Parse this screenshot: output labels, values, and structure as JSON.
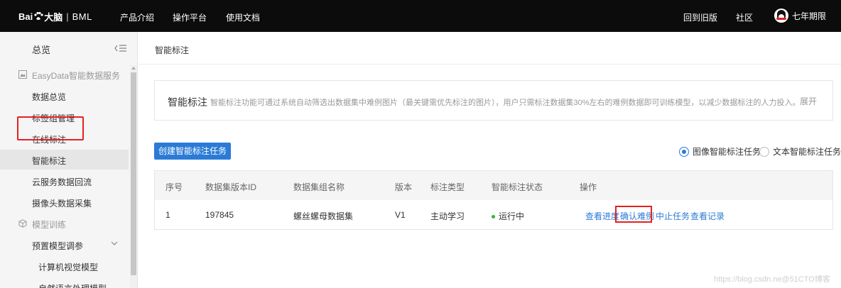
{
  "header": {
    "logo_prefix": "Bai",
    "logo_suffix": "大脑",
    "logo_sep": "|",
    "logo_product": "BML",
    "nav": [
      "产品介绍",
      "操作平台",
      "使用文档"
    ],
    "right_links": [
      "回到旧版",
      "社区"
    ],
    "username": "七年期限"
  },
  "sidebar": {
    "title": "总览",
    "groups": [
      {
        "label": "EasyData智能数据服务",
        "icon": "image-data-icon"
      },
      {
        "label": "模型训练",
        "icon": "cube-icon"
      }
    ],
    "items": [
      {
        "label": "数据总览"
      },
      {
        "label": "标签组管理"
      },
      {
        "label": "在线标注"
      },
      {
        "label": "智能标注",
        "active": true
      },
      {
        "label": "云服务数据回流"
      },
      {
        "label": "摄像头数据采集"
      },
      {
        "label": "预置模型调参"
      },
      {
        "label": "计算机视觉模型"
      },
      {
        "label": "自然语言处理模型"
      }
    ]
  },
  "main": {
    "breadcrumb": "智能标注",
    "info": {
      "title": "智能标注",
      "description": "智能标注功能可通过系统自动筛选出数据集中难例图片（最关键需优先标注的图片），用户只需标注数据集30%左右的难例数据即可训练模型，以减少数据标注的人力投入。",
      "expand": "展开"
    },
    "create_button": "创建智能标注任务",
    "task_types": [
      {
        "label": "图像智能标注任务",
        "selected": true
      },
      {
        "label": "文本智能标注任务",
        "selected": false
      }
    ],
    "table": {
      "columns": [
        "序号",
        "数据集版本ID",
        "数据集组名称",
        "版本",
        "标注类型",
        "智能标注状态",
        "操作"
      ],
      "rows": [
        {
          "index": "1",
          "dataset_version_id": "197845",
          "dataset_group_name": "螺丝螺母数据集",
          "version": "V1",
          "annotation_type": "主动学习",
          "status": "运行中",
          "actions": [
            "查看进度",
            "确认难例",
            "中止任务",
            "查看记录"
          ]
        }
      ]
    }
  },
  "watermark": "https://blog.csdn.ne@51CTO博客",
  "colors": {
    "accent": "#2b7bd6",
    "highlight": "#e62020",
    "status_running": "#2eb82e"
  }
}
